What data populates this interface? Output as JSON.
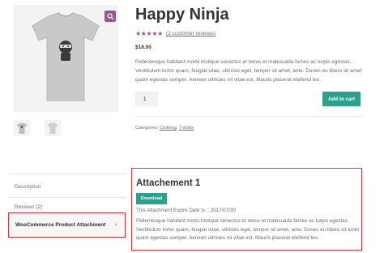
{
  "product": {
    "title": "Happy Ninja",
    "rating": {
      "stars_text": "★★★★★",
      "value_out_of_5": 5,
      "reviews_link": "2 customer reviews"
    },
    "price": "$18.00",
    "description_lines": [
      "Pellentesque habitant morbi tristique senectus et netus et malesuada fames ac turpis egestas.",
      "Vestibulum tortor quam, feugiat vitae, ultricies eget, tempor sit amet, ante. Donec eu libero sit amet",
      "quam egestas semper. Aenean ultricies mi vitae est. Mauris placerat eleifend leo."
    ],
    "quantity": "1",
    "add_to_cart_label": "Add to cart",
    "categories_label": "Categories:",
    "categories": [
      "Clothing",
      "T-shirts"
    ],
    "categories_separator": ", "
  },
  "gallery": {
    "zoom_icon": "magnifier-icon",
    "thumbnail_count": 2
  },
  "tabs": [
    {
      "label": "Description"
    },
    {
      "label": "Reviews (2)"
    },
    {
      "label": "WooCommerce Product Attachment",
      "active": true
    }
  ],
  "attachment": {
    "title": "Attachement 1",
    "download_label": "Download",
    "expire_text": "This Attachment Expire Date Is :: 2017/07/30",
    "description_lines": [
      "Pellentesque habitant morbi tristique senectus et netus et malesuada fames ac turpis egestas.",
      "Vestibulum tortor quam, feugiat vitae, ultricies eget, tempor sit amet, ante. Donec eu libero sit amet",
      "quam egestas semper. Aenean ultricies mi vitae est. Mauris placerat eleifend leo."
    ]
  },
  "colors": {
    "accent_purple": "#96588a",
    "button_teal": "#2c9f8d",
    "highlight_red": "#d23b3b"
  }
}
